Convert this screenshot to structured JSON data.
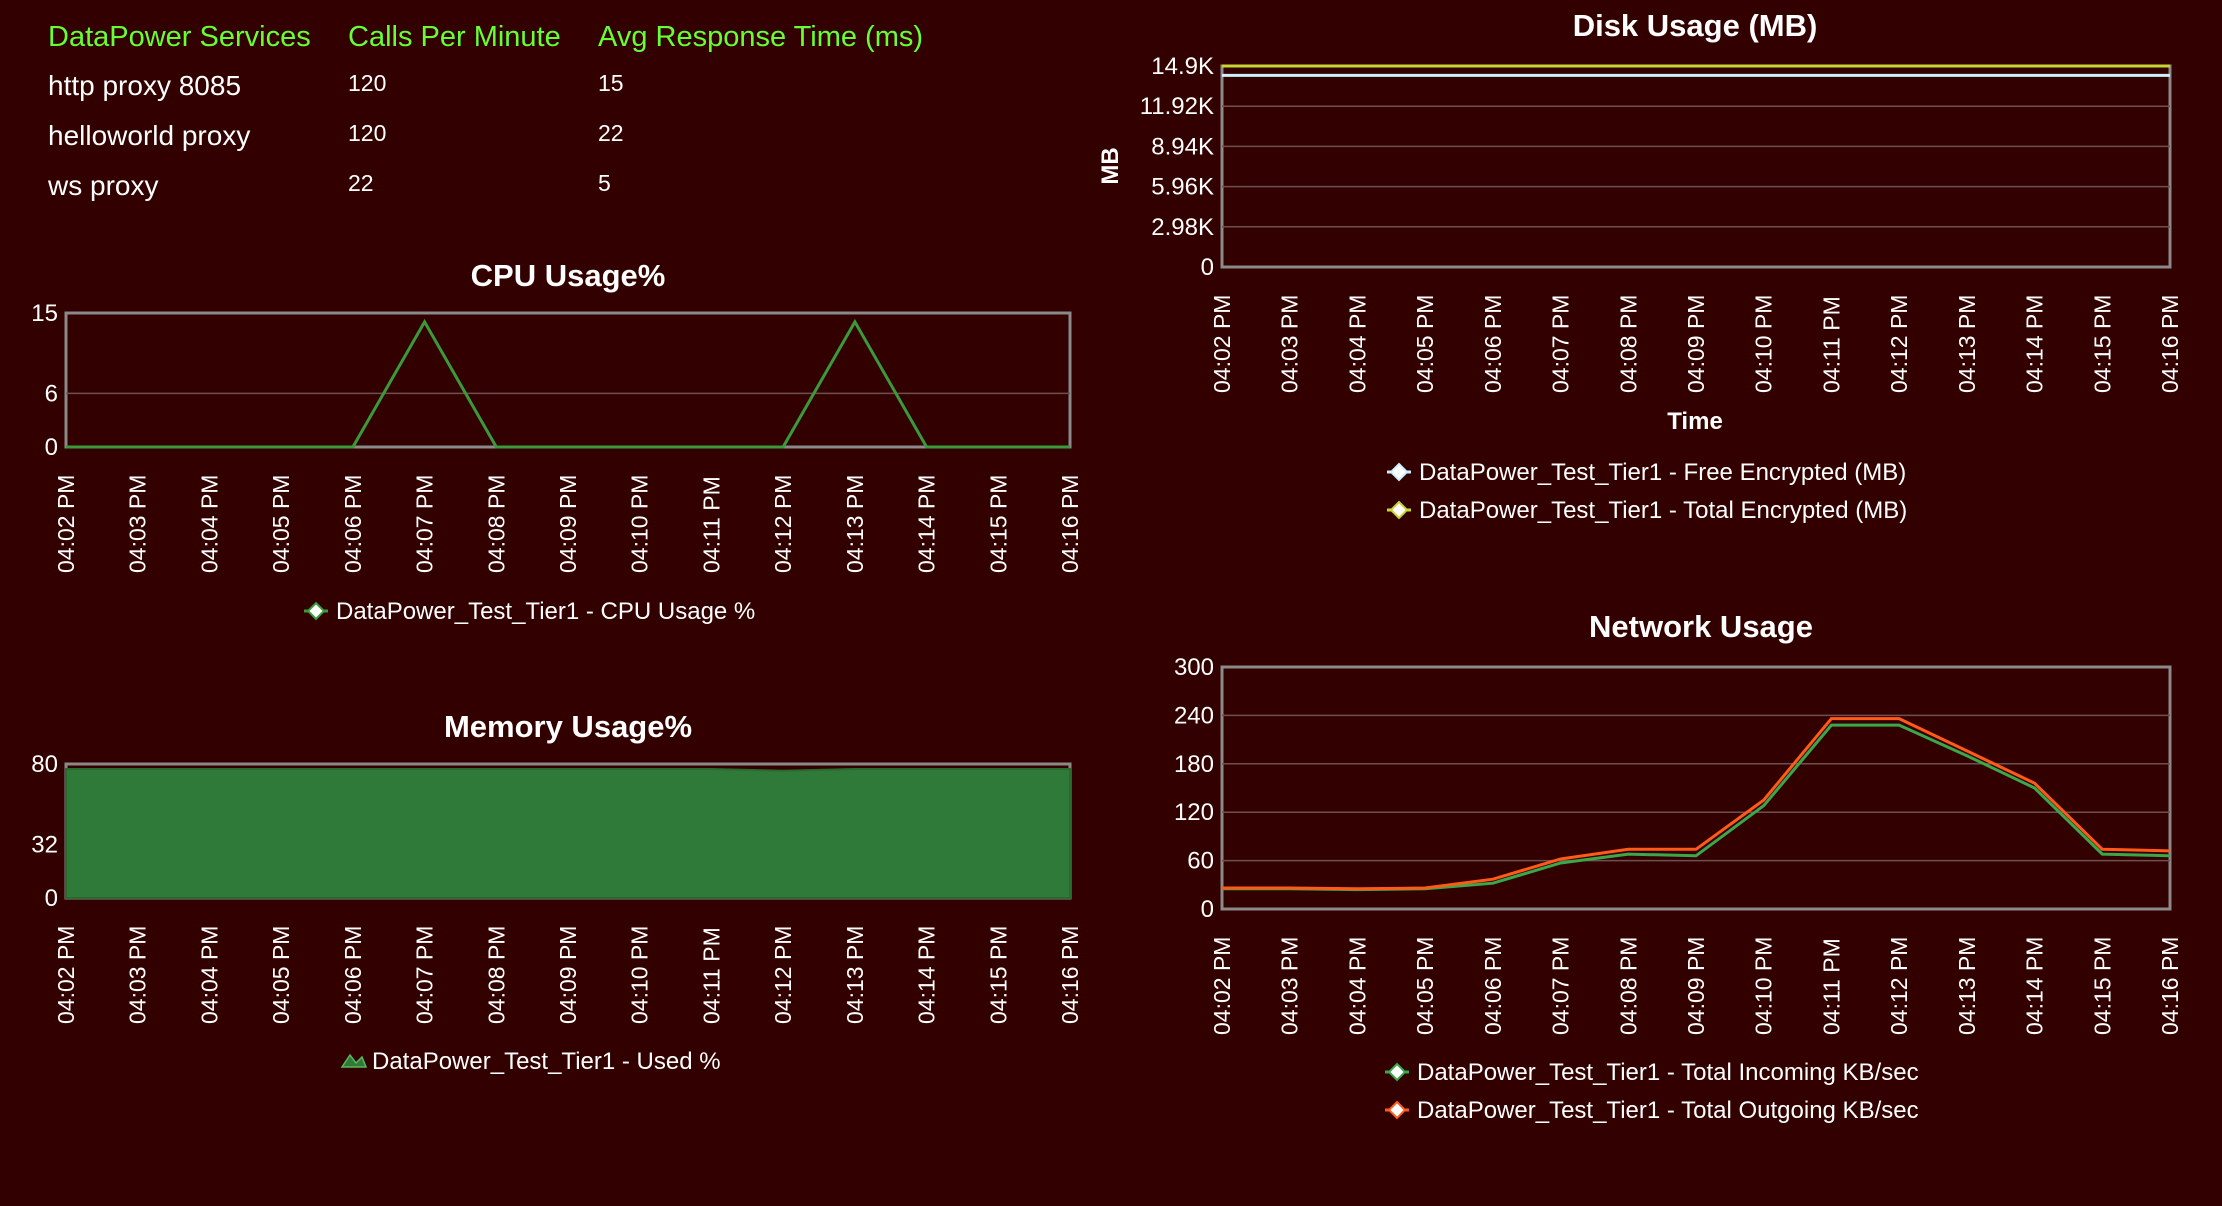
{
  "services": {
    "headers": [
      "DataPower Services",
      "Calls Per Minute",
      "Avg Response Time (ms)"
    ],
    "rows": [
      {
        "name": "http proxy 8085",
        "calls": "120",
        "avg_ms": "15"
      },
      {
        "name": "helloworld proxy",
        "calls": "120",
        "avg_ms": "22"
      },
      {
        "name": "ws proxy",
        "calls": "22",
        "avg_ms": "5"
      }
    ]
  },
  "colors": {
    "background": "#330000",
    "header_green": "#66ff33",
    "cpu_line": "#3a9a3a",
    "memory_fill": "#2f7a38",
    "disk_free": "#ccf0ff",
    "disk_total": "#c8d632",
    "net_incoming": "#3aa84a",
    "net_outgoing": "#ff5a1a"
  },
  "chart_data": [
    {
      "id": "cpu",
      "type": "line",
      "title": "CPU Usage%",
      "xlabel": "",
      "ylabel": "",
      "ylim": [
        0,
        15
      ],
      "yticks": [
        "0",
        "6",
        "15"
      ],
      "ytick_values": [
        0,
        6,
        15
      ],
      "categories": [
        "04:02 PM",
        "04:03 PM",
        "04:04 PM",
        "04:05 PM",
        "04:06 PM",
        "04:07 PM",
        "04:08 PM",
        "04:09 PM",
        "04:10 PM",
        "04:11 PM",
        "04:12 PM",
        "04:13 PM",
        "04:14 PM",
        "04:15 PM",
        "04:16 PM"
      ],
      "series": [
        {
          "name": "DataPower_Test_Tier1 - CPU Usage %",
          "values": [
            0,
            0,
            0,
            0,
            0,
            14,
            0,
            0,
            0,
            0,
            0,
            14,
            0,
            0,
            0
          ]
        }
      ],
      "legend_position": "bottom",
      "grid": true
    },
    {
      "id": "memory",
      "type": "area",
      "title": "Memory Usage%",
      "xlabel": "",
      "ylabel": "",
      "ylim": [
        0,
        80
      ],
      "yticks": [
        "0",
        "32",
        "80"
      ],
      "ytick_values": [
        0,
        32,
        80
      ],
      "categories": [
        "04:02 PM",
        "04:03 PM",
        "04:04 PM",
        "04:05 PM",
        "04:06 PM",
        "04:07 PM",
        "04:08 PM",
        "04:09 PM",
        "04:10 PM",
        "04:11 PM",
        "04:12 PM",
        "04:13 PM",
        "04:14 PM",
        "04:15 PM",
        "04:16 PM"
      ],
      "series": [
        {
          "name": "DataPower_Test_Tier1 - Used %",
          "values": [
            77,
            77,
            77,
            77,
            77,
            77,
            77,
            77,
            77,
            77,
            76,
            77,
            77,
            77,
            77
          ]
        }
      ],
      "legend_position": "bottom",
      "grid": true
    },
    {
      "id": "disk",
      "type": "line",
      "title": "Disk Usage (MB)",
      "xlabel": "Time",
      "ylabel": "MB",
      "ylim": [
        0,
        14900
      ],
      "yticks": [
        "0",
        "2.98K",
        "5.96K",
        "8.94K",
        "11.92K",
        "14.9K"
      ],
      "ytick_values": [
        0,
        2980,
        5960,
        8940,
        11920,
        14900
      ],
      "categories": [
        "04:02 PM",
        "04:03 PM",
        "04:04 PM",
        "04:05 PM",
        "04:06 PM",
        "04:07 PM",
        "04:08 PM",
        "04:09 PM",
        "04:10 PM",
        "04:11 PM",
        "04:12 PM",
        "04:13 PM",
        "04:14 PM",
        "04:15 PM",
        "04:16 PM"
      ],
      "series": [
        {
          "name": "DataPower_Test_Tier1 - Free Encrypted (MB)",
          "values": [
            14200,
            14200,
            14200,
            14200,
            14200,
            14200,
            14200,
            14200,
            14200,
            14200,
            14200,
            14200,
            14200,
            14200,
            14200
          ]
        },
        {
          "name": "DataPower_Test_Tier1 - Total Encrypted (MB)",
          "values": [
            14900,
            14900,
            14900,
            14900,
            14900,
            14900,
            14900,
            14900,
            14900,
            14900,
            14900,
            14900,
            14900,
            14900,
            14900
          ]
        }
      ],
      "legend_position": "bottom",
      "grid": true
    },
    {
      "id": "network",
      "type": "line",
      "title": "Network Usage",
      "xlabel": "",
      "ylabel": "",
      "ylim": [
        0,
        300
      ],
      "yticks": [
        "0",
        "60",
        "120",
        "180",
        "240",
        "300"
      ],
      "ytick_values": [
        0,
        60,
        120,
        180,
        240,
        300
      ],
      "categories": [
        "04:02 PM",
        "04:03 PM",
        "04:04 PM",
        "04:05 PM",
        "04:06 PM",
        "04:07 PM",
        "04:08 PM",
        "04:09 PM",
        "04:10 PM",
        "04:11 PM",
        "04:12 PM",
        "04:13 PM",
        "04:14 PM",
        "04:15 PM",
        "04:16 PM"
      ],
      "series": [
        {
          "name": "DataPower_Test_Tier1 - Total Incoming KB/sec",
          "values": [
            25,
            25,
            24,
            25,
            32,
            57,
            68,
            66,
            128,
            228,
            228,
            190,
            150,
            68,
            66
          ]
        },
        {
          "name": "DataPower_Test_Tier1 - Total Outgoing KB/sec",
          "values": [
            26,
            26,
            25,
            26,
            37,
            62,
            74,
            74,
            135,
            236,
            236,
            196,
            156,
            74,
            72
          ]
        }
      ],
      "legend_position": "bottom",
      "grid": true
    }
  ]
}
